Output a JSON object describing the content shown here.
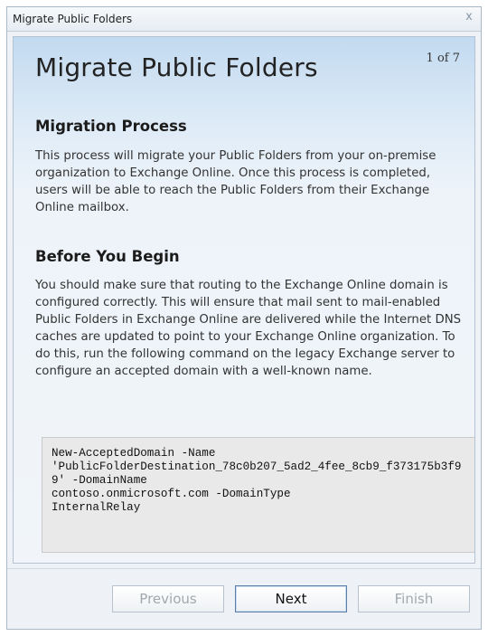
{
  "window": {
    "title": "Migrate Public Folders",
    "close_glyph": "x"
  },
  "header": {
    "title": "Migrate Public Folders",
    "step": "1 of 7"
  },
  "sections": [
    {
      "heading": "Migration Process",
      "body": "This process will migrate your Public Folders from your on-premise organization to Exchange Online.  Once this process is completed, users will be able to reach the Public Folders from their Exchange Online mailbox."
    },
    {
      "heading": "Before You Begin",
      "body": "You should make sure that routing to the Exchange Online domain is configured correctly.  This will ensure that mail sent to mail-enabled Public Folders in Exchange Online are delivered while the Internet DNS caches are updated to point to your Exchange Online organization. To do this, run the following command on the legacy Exchange server to configure an accepted domain with a well-known name."
    }
  ],
  "command": "New-AcceptedDomain -Name\n'PublicFolderDestination_78c0b207_5ad2_4fee_8cb9_f373175b3f99' -DomainName\ncontoso.onmicrosoft.com -DomainType\nInternalRelay",
  "buttons": {
    "previous": "Previous",
    "next": "Next",
    "finish": "Finish"
  },
  "icons": {
    "close": "close-icon"
  },
  "colors": {
    "header_gradient_top": "#c2daf0",
    "panel_background": "#f1f5f9",
    "code_background": "#e9e9e9",
    "primary_button_border": "#5d7ea6"
  }
}
